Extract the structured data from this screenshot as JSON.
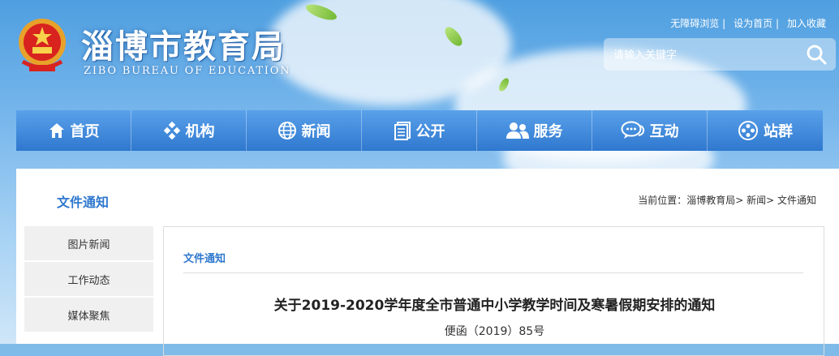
{
  "header": {
    "title": "淄博市教育局",
    "subtitle": "ZIBO BUREAU OF EDUCATION",
    "top_links": [
      "无障碍浏览 |",
      "设为首页 |",
      "加入收藏"
    ],
    "search_placeholder": "请输入关键字"
  },
  "nav": [
    {
      "label": "首页",
      "icon": "home-icon"
    },
    {
      "label": "机构",
      "icon": "diamonds-icon"
    },
    {
      "label": "新闻",
      "icon": "globe-icon"
    },
    {
      "label": "公开",
      "icon": "document-icon"
    },
    {
      "label": "服务",
      "icon": "people-icon"
    },
    {
      "label": "互动",
      "icon": "chat-icon"
    },
    {
      "label": "站群",
      "icon": "compass-icon"
    }
  ],
  "content": {
    "section_title": "文件通知",
    "breadcrumb": "当前位置：淄博教育局> 新闻> 文件通知",
    "sidebar": [
      "图片新闻",
      "工作动态",
      "媒体聚焦"
    ],
    "main_heading": "文件通知",
    "article_title": "关于2019-2020学年度全市普通中小学教学时间及寒暑假期安排的通知",
    "article_doc_no": "便函（2019）85号"
  },
  "colors": {
    "nav_blue": "#2f78cf",
    "accent": "#2f78cf"
  }
}
